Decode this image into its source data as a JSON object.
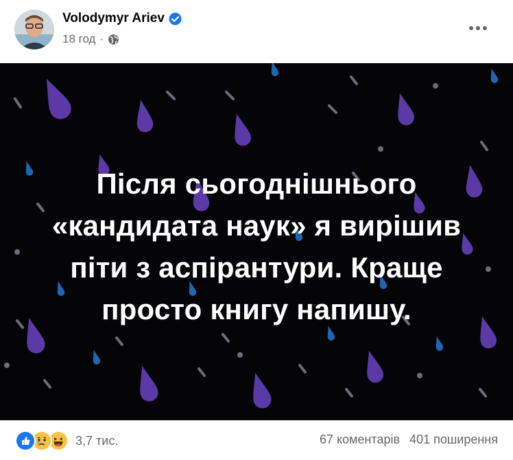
{
  "post": {
    "author": "Volodymyr Ariev",
    "timestamp": "18 год",
    "separator": "·",
    "privacy_icon": "globe-icon",
    "verified_icon": "verified-badge-icon",
    "more_icon": "more-options-icon"
  },
  "image_text": {
    "lines": [
      "Після сьогоднішнього",
      "«кандидата наук» я вирішив",
      "піти з аспірантури. Краще",
      "просто книгу напишу."
    ]
  },
  "footer": {
    "reactions_icons": [
      "like-icon",
      "sad-icon",
      "haha-icon"
    ],
    "reactions_count": "3,7 тис.",
    "comments": "67 коментарів",
    "shares": "401 поширення"
  },
  "colors": {
    "accent": "#1877f2",
    "image_bg": "#050507",
    "drop_purple": "#5b3aa8",
    "drop_blue": "#1e66b4",
    "drop_gray": "#6b6e7a"
  }
}
